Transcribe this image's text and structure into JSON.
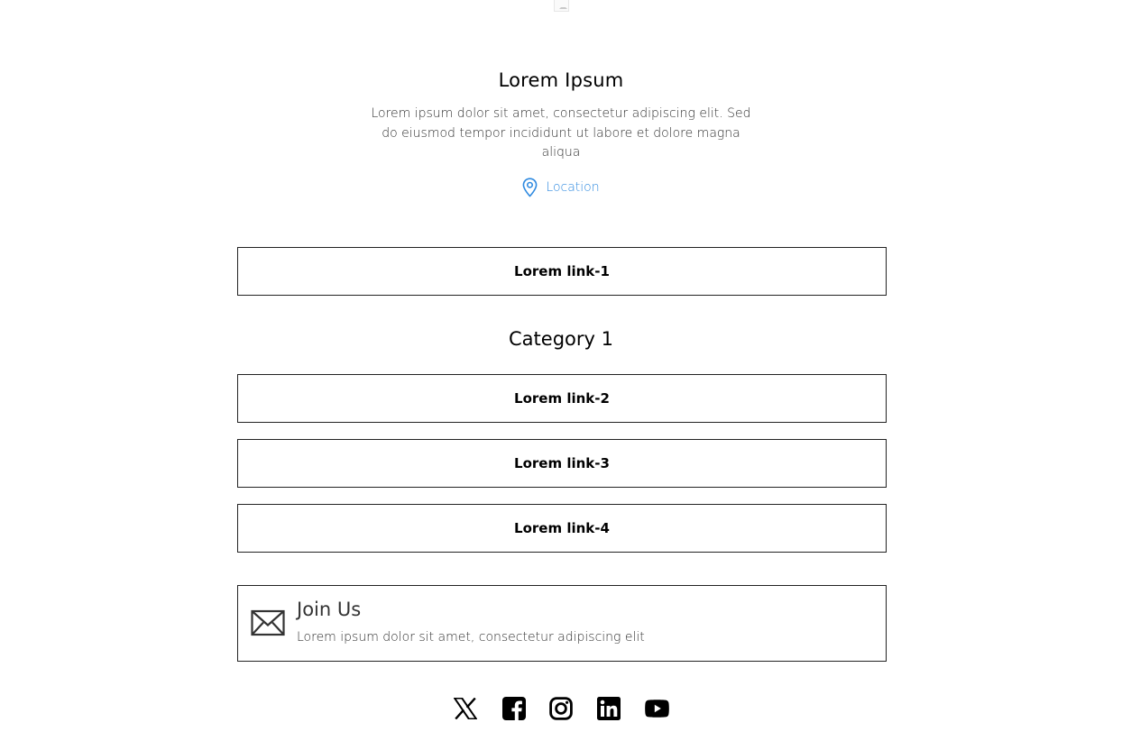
{
  "profile": {
    "title": "Lorem Ipsum",
    "description": "Lorem ipsum dolor sit amet, consectetur adipiscing elit. Sed do eiusmod tempor incididunt ut labore et dolore magna aliqua",
    "location_label": "Location",
    "location_color": "#2f8ae0"
  },
  "links": {
    "top": "Lorem link-1",
    "category_title": "Category 1",
    "category_items": [
      "Lorem link-2",
      "Lorem link-3",
      "Lorem link-4"
    ]
  },
  "join": {
    "icon": "envelope-icon",
    "title": "Join Us",
    "description": "Lorem ipsum dolor sit amet, consectetur adipiscing elit"
  },
  "socials": [
    "x-icon",
    "facebook-icon",
    "instagram-icon",
    "linkedin-icon",
    "youtube-icon"
  ]
}
